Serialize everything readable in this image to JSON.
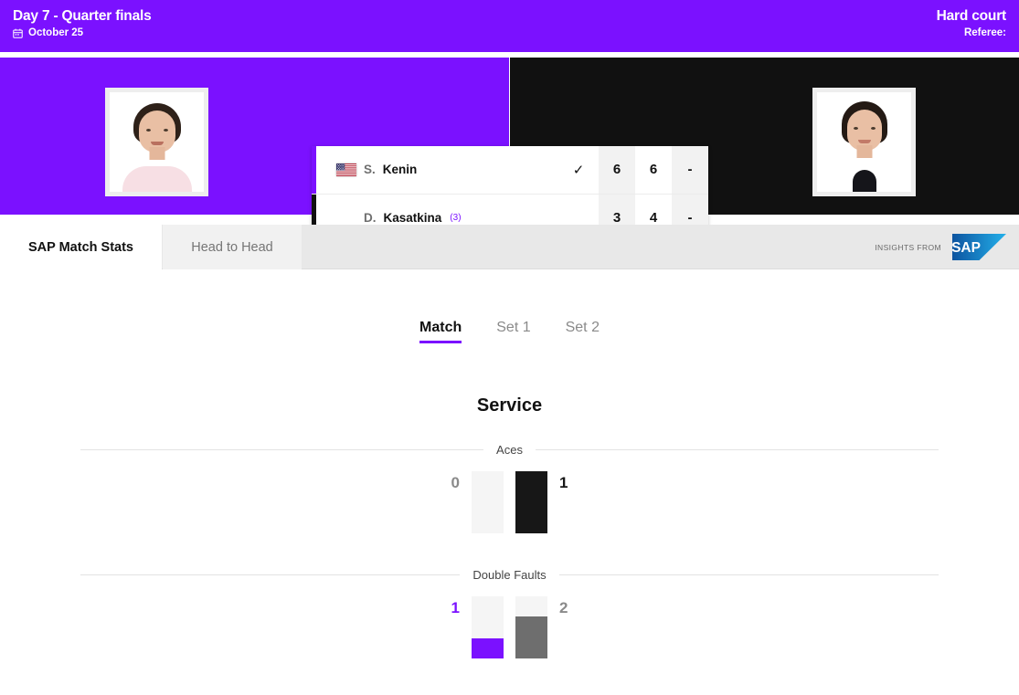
{
  "header": {
    "title": "Day 7 - Quarter finals",
    "date": "October 25",
    "calendar_icon": "calendar-icon",
    "surface": "Hard court",
    "referee": "Referee:"
  },
  "scorecard": {
    "players": [
      {
        "accent_color": "#7b11ff",
        "flag_icon": "flag-usa-icon",
        "has_flag": true,
        "initial": "S.",
        "last_name": "Kenin",
        "seed": "",
        "winner_check": "✓",
        "scores": [
          "6",
          "6",
          "-"
        ]
      },
      {
        "accent_color": "#111111",
        "flag_icon": "",
        "has_flag": false,
        "initial": "D.",
        "last_name": "Kasatkina",
        "seed": "(3)",
        "winner_check": "",
        "scores": [
          "3",
          "4",
          "-"
        ]
      }
    ]
  },
  "tabs": {
    "items": [
      {
        "label": "SAP Match Stats",
        "selected": true
      },
      {
        "label": "Head to Head",
        "selected": false
      }
    ],
    "insights_label": "INSIGHTS FROM",
    "sap_logo": "sap-logo"
  },
  "stats": {
    "set_nav": [
      {
        "label": "Match",
        "selected": true
      },
      {
        "label": "Set 1",
        "selected": false
      },
      {
        "label": "Set 2",
        "selected": false
      }
    ],
    "section_title": "Service"
  },
  "chart_data": [
    {
      "type": "bar",
      "title": "Aces",
      "categories": [
        "S. Kenin",
        "D. Kasatkina"
      ],
      "values": [
        0,
        1
      ],
      "left_value": "0",
      "right_value": "1",
      "left_fill_pct": 0,
      "right_fill_pct": 100,
      "left_color": "#7b11ff",
      "right_color": "#171717",
      "track_color": "#f5f5f5",
      "left_label_color": "#8a8a8a",
      "right_label_color": "#171717",
      "ylim": [
        0,
        1
      ]
    },
    {
      "type": "bar",
      "title": "Double Faults",
      "categories": [
        "S. Kenin",
        "D. Kasatkina"
      ],
      "values": [
        1,
        2
      ],
      "left_value": "1",
      "right_value": "2",
      "left_fill_pct": 33,
      "right_fill_pct": 67,
      "left_color": "#7b11ff",
      "right_color": "#6e6e6e",
      "track_color": "#f5f5f5",
      "left_label_color": "#7b11ff",
      "right_label_color": "#8a8a8a",
      "ylim": [
        0,
        2
      ]
    }
  ]
}
